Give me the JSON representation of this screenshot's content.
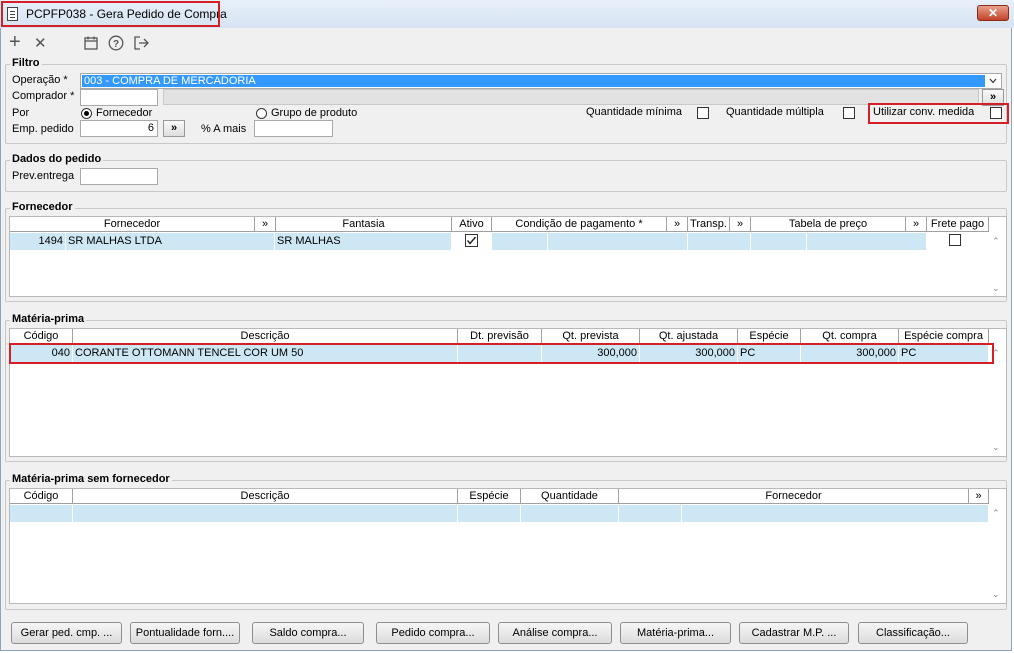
{
  "window": {
    "title": "PCPFP038 - Gera Pedido de Compra",
    "close_label": "✕"
  },
  "toolbar": {
    "add": "+",
    "delete": "✕",
    "calendar": "calendar",
    "help": "?",
    "exit": "exit"
  },
  "filtro": {
    "legend": "Filtro",
    "operacao_label": "Operação *",
    "operacao_value": "003 - COMPRA DE MERCADORIA",
    "comprador_label": "Comprador *",
    "comprador_value": "",
    "por_label": "Por",
    "radio_fornecedor": "Fornecedor",
    "radio_grupo": "Grupo de produto",
    "qtd_minima": "Quantidade mínima",
    "qtd_multipla": "Quantidade múltipla",
    "conv_medida": "Utilizar conv. medida",
    "emp_label": "Emp. pedido",
    "emp_value": "6",
    "amais_label": "% A mais",
    "amais_value": "",
    "go": "»"
  },
  "dados": {
    "legend": "Dados do pedido",
    "prev_label": "Prev.entrega",
    "prev_value": ""
  },
  "fornecedor": {
    "legend": "Fornecedor",
    "headers": {
      "fornecedor": "Fornecedor",
      "fantasia": "Fantasia",
      "ativo": "Ativo",
      "condicao": "Condição de pagamento *",
      "transp": "Transp.",
      "tabela": "Tabela de preço",
      "frete": "Frete pago",
      "expand": "»"
    },
    "row": {
      "codigo": "1494",
      "nome": "SR MALHAS LTDA",
      "fantasia": "SR  MALHAS",
      "ativo": true
    }
  },
  "materia": {
    "legend": "Matéria-prima",
    "headers": {
      "codigo": "Código",
      "descricao": "Descrição",
      "dt": "Dt. previsão",
      "qt_prev": "Qt. prevista",
      "qt_aj": "Qt. ajustada",
      "especie": "Espécie",
      "qt_compra": "Qt. compra",
      "esp_compra": "Espécie compra"
    },
    "row": {
      "codigo": "040",
      "descricao": "CORANTE OTTOMANN TENCEL COR UM 50",
      "dt": "",
      "qt_prev": "300,000",
      "qt_aj": "300,000",
      "especie": "PC",
      "qt_compra": "300,000",
      "esp_compra": "PC"
    }
  },
  "semforn": {
    "legend": "Matéria-prima sem fornecedor",
    "headers": {
      "codigo": "Código",
      "descricao": "Descrição",
      "especie": "Espécie",
      "quantidade": "Quantidade",
      "fornecedor": "Fornecedor",
      "expand": "»"
    }
  },
  "buttons": [
    "Gerar ped. cmp. ...",
    "Pontualidade forn....",
    "Saldo compra...",
    "Pedido compra...",
    "Análise compra...",
    "Matéria-prima...",
    "Cadastrar M.P. ...",
    "Classificação..."
  ]
}
